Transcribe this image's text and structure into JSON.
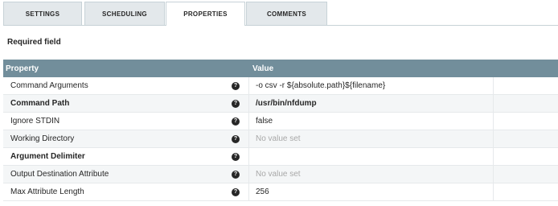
{
  "tabs": [
    {
      "label": "SETTINGS",
      "active": false
    },
    {
      "label": "SCHEDULING",
      "active": false
    },
    {
      "label": "PROPERTIES",
      "active": true
    },
    {
      "label": "COMMENTS",
      "active": false
    }
  ],
  "required_label": "Required field",
  "grid": {
    "header": {
      "property": "Property",
      "value": "Value"
    },
    "info_icon": "question-circle-icon",
    "rows": [
      {
        "name": "Command Arguments",
        "required": false,
        "value": "-o csv -r ${absolute.path}${filename}",
        "empty": false
      },
      {
        "name": "Command Path",
        "required": true,
        "value": "/usr/bin/nfdump",
        "empty": false
      },
      {
        "name": "Ignore STDIN",
        "required": false,
        "value": "false",
        "empty": false
      },
      {
        "name": "Working Directory",
        "required": false,
        "value": "No value set",
        "empty": true
      },
      {
        "name": "Argument Delimiter",
        "required": true,
        "value": "",
        "empty": false
      },
      {
        "name": "Output Destination Attribute",
        "required": false,
        "value": "No value set",
        "empty": true
      },
      {
        "name": "Max Attribute Length",
        "required": false,
        "value": "256",
        "empty": false
      }
    ]
  },
  "colors": {
    "header_bg": "#728e9b",
    "tab_bg": "#e3e8eb",
    "empty_text": "#a8a8a8"
  }
}
